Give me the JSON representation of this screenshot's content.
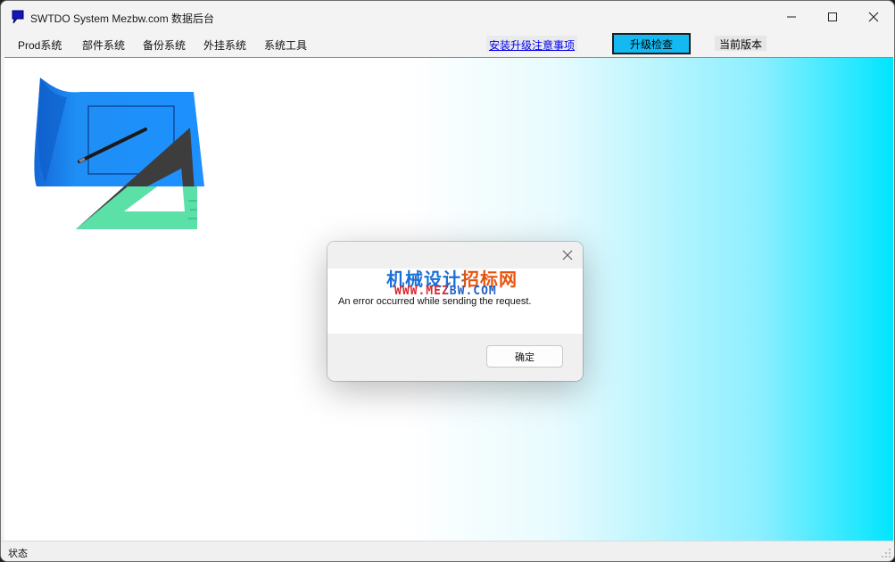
{
  "window": {
    "title": "SWTDO System Mezbw.com 数据后台"
  },
  "menubar": {
    "items": [
      {
        "label": "Prod系统"
      },
      {
        "label": "部件系统"
      },
      {
        "label": "备份系统"
      },
      {
        "label": "外挂系统"
      },
      {
        "label": "系统工具"
      }
    ],
    "upgrade_notes_link": "安装升级注意事项",
    "upgrade_check_button": "升级检查",
    "current_version_label": "当前版本"
  },
  "dialog": {
    "watermark_title": "机械设计招标网",
    "watermark_url": "WWW.MEZBW.COM",
    "message": "An error occurred while sending the request.",
    "ok_label": "确定"
  },
  "statusbar": {
    "text": "状态"
  },
  "icons": {
    "app": "app-icon",
    "minimize": "minimize-icon",
    "maximize": "maximize-icon",
    "close": "close-icon",
    "dialog_close": "dialog-close-icon",
    "size_grip": "size-grip-icon",
    "logo": "drafting-logo"
  },
  "colors": {
    "upgrade_button_bg": "#13b9f0",
    "content_gradient_end": "#00e5ff",
    "logo_paper": "#1e90ff",
    "logo_triangle": "#5be0a8"
  }
}
